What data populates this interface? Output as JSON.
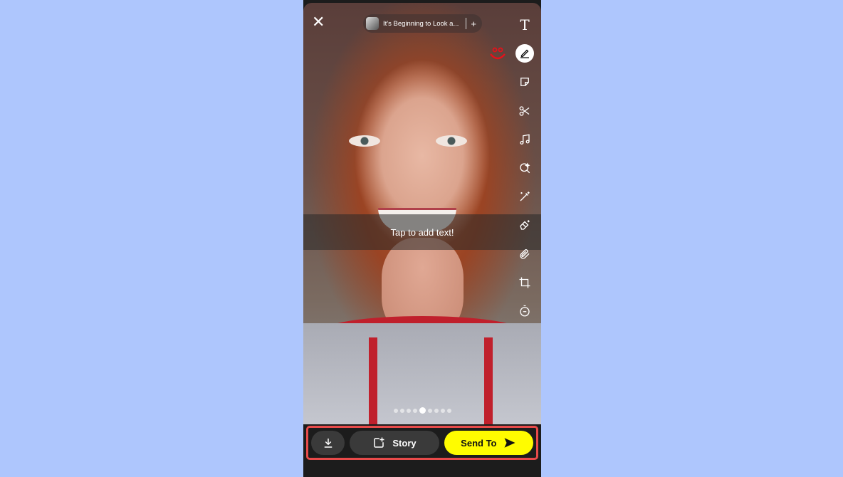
{
  "top": {
    "close_icon": "close-icon",
    "music": {
      "title": "It's Beginning to Look a...",
      "add_label": "+"
    }
  },
  "tools": [
    {
      "name": "text",
      "icon": "text-icon",
      "glyph": "T"
    },
    {
      "name": "draw",
      "icon": "pencil-icon",
      "active": true
    },
    {
      "name": "sticker",
      "icon": "sticker-icon"
    },
    {
      "name": "scissors",
      "icon": "scissors-icon"
    },
    {
      "name": "music",
      "icon": "music-note-icon"
    },
    {
      "name": "lens",
      "icon": "lens-search-icon"
    },
    {
      "name": "magic",
      "icon": "magic-wand-icon"
    },
    {
      "name": "eraser",
      "icon": "magic-eraser-icon"
    },
    {
      "name": "attach",
      "icon": "paperclip-icon"
    },
    {
      "name": "crop",
      "icon": "crop-icon"
    },
    {
      "name": "timer",
      "icon": "timer-icon"
    }
  ],
  "canvas": {
    "text_placeholder": "Tap to add text!"
  },
  "pager": {
    "count": 9,
    "active_index": 4
  },
  "bottom": {
    "download_icon": "download-icon",
    "story_label": "Story",
    "send_label": "Send To",
    "send_color": "#fffc00",
    "highlight_color": "#e84a4a"
  }
}
